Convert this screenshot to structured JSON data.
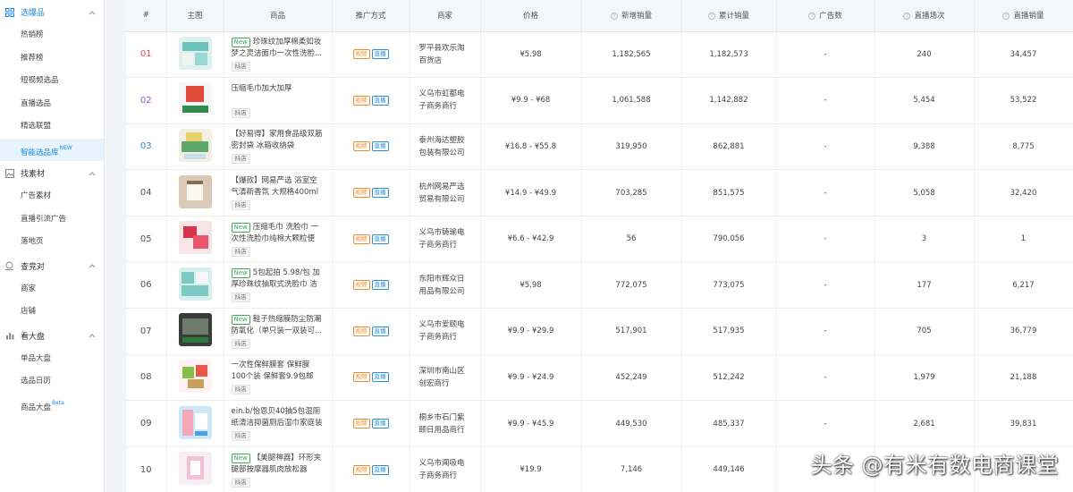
{
  "sidebar": {
    "groups": [
      {
        "label": "选爆品",
        "icon": "grid-icon",
        "active": true,
        "items": [
          {
            "label": "热销榜"
          },
          {
            "label": "推荐榜"
          },
          {
            "label": "短视频选品"
          },
          {
            "label": "直播选品"
          },
          {
            "label": "精选联盟"
          },
          {
            "label": "智能选品库",
            "badge": "NEW",
            "active": true
          }
        ]
      },
      {
        "label": "找素材",
        "icon": "image-icon",
        "items": [
          {
            "label": "广告素材"
          },
          {
            "label": "直播引流广告"
          },
          {
            "label": "落地页"
          }
        ]
      },
      {
        "label": "查竞对",
        "icon": "spy-icon",
        "items": [
          {
            "label": "商家"
          },
          {
            "label": "店铺"
          }
        ]
      },
      {
        "label": "看大盘",
        "icon": "bar-chart-icon",
        "items": [
          {
            "label": "单品大盘"
          },
          {
            "label": "选品日历"
          },
          {
            "label": "商品大盘",
            "badge": "Beta"
          }
        ]
      }
    ]
  },
  "table": {
    "columns": [
      "#",
      "主图",
      "商品",
      "推广方式",
      "商家",
      "价格",
      "新增销量",
      "累计销量",
      "广告数",
      "直播场次",
      "直播销量"
    ],
    "promo_labels": {
      "video": "视频",
      "live": "直播"
    },
    "store_tag": "抖店",
    "new_tag": "New",
    "rows": [
      {
        "rank": "01",
        "name": "珍珠纹加厚棉柔如妆梦之灵洁面巾一次性洗脸...",
        "is_new": true,
        "merchant": "罗平县欢乐淘百货店",
        "price": "¥5.98",
        "new_sales": "1,182,565",
        "total_sales": "1,182,573",
        "ads": "-",
        "live_sessions": "240",
        "live_sales": "34,457"
      },
      {
        "rank": "02",
        "name": "压缩毛巾加大加厚",
        "is_new": false,
        "merchant": "义乌市虹都电子商务商行",
        "price": "¥9.9 - ¥68",
        "new_sales": "1,061,588",
        "total_sales": "1,142,882",
        "ads": "-",
        "live_sessions": "5,454",
        "live_sales": "53,522"
      },
      {
        "rank": "03",
        "name": "【好易得】家用食品级双筋密封袋 冰箱收纳袋",
        "is_new": false,
        "merchant": "泰州海达塑胶包装有限公司",
        "price": "¥16.8 - ¥55.8",
        "new_sales": "319,950",
        "total_sales": "862,881",
        "ads": "-",
        "live_sessions": "9,388",
        "live_sales": "8,775"
      },
      {
        "rank": "04",
        "name": "【爆款】网易严选 浴室空气清新香氛 大规格400ml",
        "is_new": false,
        "merchant": "杭州网易严选贸易有限公司",
        "price": "¥14.9 - ¥49.9",
        "new_sales": "703,285",
        "total_sales": "851,575",
        "ads": "-",
        "live_sessions": "5,058",
        "live_sales": "32,420"
      },
      {
        "rank": "05",
        "name": "压缩毛巾 洗脸巾 一次性洗脸巾纯棉大颗粒便携...",
        "is_new": true,
        "merchant": "义乌市铸瑜电子商务商行",
        "price": "¥6.6 - ¥42.9",
        "new_sales": "56",
        "total_sales": "790,056",
        "ads": "-",
        "live_sessions": "3",
        "live_sales": "1"
      },
      {
        "rank": "06",
        "name": "5包起拍 5.98/包 加厚珍珠纹抽取式洗脸巾 洁面...",
        "is_new": true,
        "merchant": "东阳市辉众日用品有限公司",
        "price": "¥5.98",
        "new_sales": "772,075",
        "total_sales": "773,075",
        "ads": "-",
        "live_sessions": "177",
        "live_sales": "6,217"
      },
      {
        "rank": "07",
        "name": "鞋子热缩膜防尘防潮防氧化（单只装一双装可...",
        "is_new": true,
        "merchant": "义乌市爱颐电子商务商行",
        "price": "¥9.9 - ¥29.9",
        "new_sales": "517,901",
        "total_sales": "517,935",
        "ads": "-",
        "live_sessions": "705",
        "live_sales": "36,779"
      },
      {
        "rank": "08",
        "name": "一次性保鲜膜套 保鲜膜 100个装 保鲜套9.9包邮",
        "is_new": false,
        "merchant": "深圳市南山区创宏商行",
        "price": "¥9.9 - ¥24.9",
        "new_sales": "452,249",
        "total_sales": "512,242",
        "ads": "-",
        "live_sessions": "1,979",
        "live_sales": "21,188"
      },
      {
        "rank": "09",
        "name": "ein.b/怡恩贝40抽5包湿厕纸清洁抑菌厕后湿巾家庭装",
        "is_new": false,
        "merchant": "桐乡市石门紫颐日用品商行",
        "price": "¥9.9 - ¥45.9",
        "new_sales": "449,530",
        "total_sales": "485,337",
        "ads": "-",
        "live_sessions": "2,681",
        "live_sales": "39,831"
      },
      {
        "rank": "10",
        "name": "【美腿神器】环形夹腿部按摩器肌肉放松器 小...",
        "is_new": true,
        "merchant": "义乌市闻吸电子商务商行",
        "price": "¥19.9",
        "new_sales": "7,146",
        "total_sales": "449,146",
        "ads": "-",
        "live_sessions": "",
        "live_sales": ""
      }
    ]
  },
  "watermark": "头条 @有米有数电商课堂",
  "colors": {
    "accent": "#1f88e5",
    "rank1": "#e8474b",
    "rank2": "#9854c6",
    "rank3": "#3a87d6",
    "video_tag": "#f08a2c",
    "live_tag": "#2a8fd8",
    "new_tag": "#3fa65a"
  }
}
